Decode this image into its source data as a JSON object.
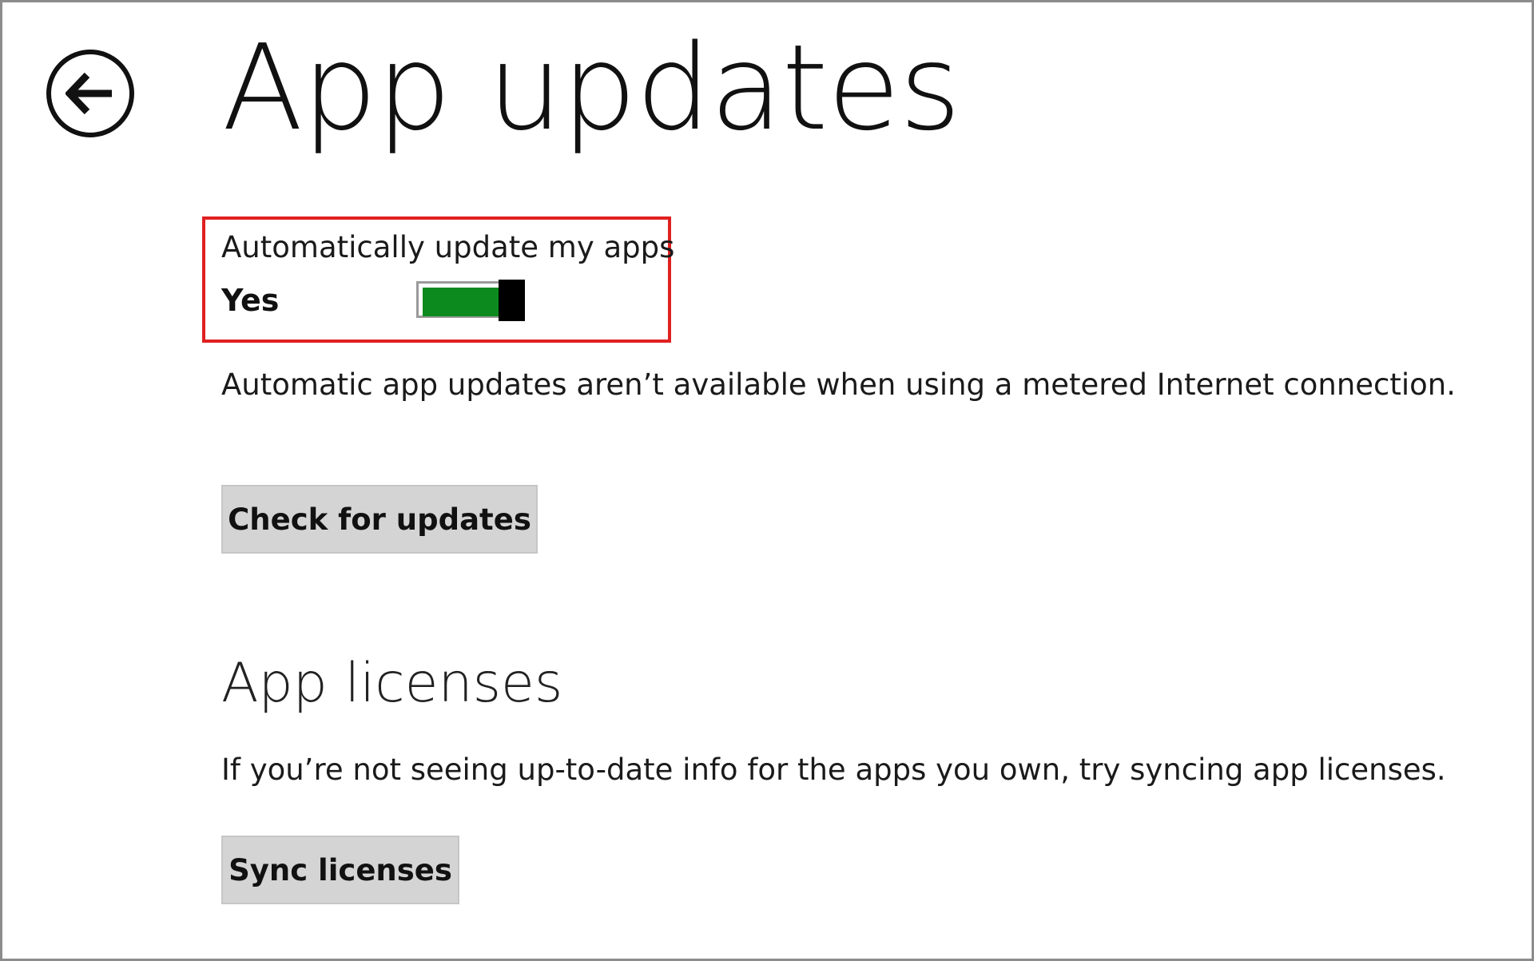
{
  "header": {
    "back_icon": "back-arrow-icon",
    "title": "App updates"
  },
  "auto_update": {
    "label": "Automatically update my apps",
    "state_text": "Yes",
    "enabled": true,
    "on_color": "#0c8a1e",
    "highlight_color": "#e02020"
  },
  "metered_note": "Automatic app updates aren’t available when using a metered Internet connection.",
  "check_updates": {
    "label": "Check for updates"
  },
  "licenses": {
    "title": "App licenses",
    "description": "If you’re not seeing up-to-date info for the apps you own, try syncing app licenses.",
    "sync_label": "Sync licenses"
  }
}
